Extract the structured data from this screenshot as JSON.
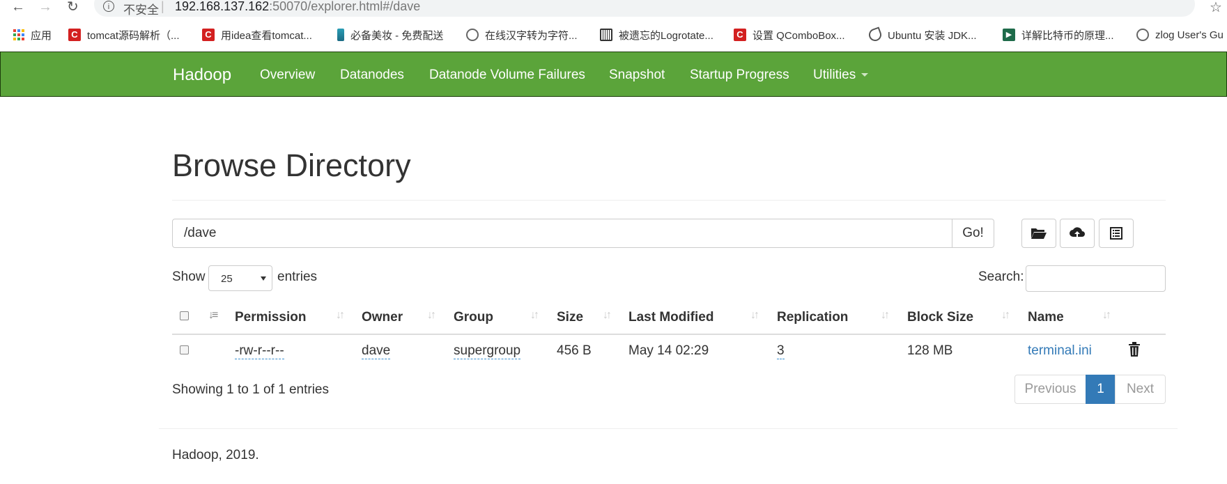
{
  "browser": {
    "insecure_label": "不安全",
    "url_host": "192.168.137.162",
    "url_rest": ":50070/explorer.html#/dave"
  },
  "bookmarks": [
    {
      "label": "应用",
      "icon": "apps-grid-icon"
    },
    {
      "label": "tomcat源码解析（...",
      "icon": "csdn-icon"
    },
    {
      "label": "用idea查看tomcat...",
      "icon": "csdn-icon"
    },
    {
      "label": "必备美妆 - 免费配送",
      "icon": "cup-icon"
    },
    {
      "label": "在线汉字转为字符...",
      "icon": "globe-icon"
    },
    {
      "label": "被遗忘的Logrotate...",
      "icon": "frame-icon"
    },
    {
      "label": "设置 QComboBox...",
      "icon": "csdn-icon"
    },
    {
      "label": "Ubuntu 安装 JDK...",
      "icon": "ubuntu-icon"
    },
    {
      "label": "详解比特币的原理...",
      "icon": "play-icon"
    },
    {
      "label": "zlog User's Gu",
      "icon": "globe-icon"
    }
  ],
  "navbar": {
    "brand": "Hadoop",
    "items": [
      "Overview",
      "Datanodes",
      "Datanode Volume Failures",
      "Snapshot",
      "Startup Progress",
      "Utilities"
    ]
  },
  "page": {
    "title": "Browse Directory",
    "path_value": "/dave",
    "go_label": "Go!"
  },
  "controls": {
    "show_label": "Show",
    "page_size": "25",
    "entries_label": "entries",
    "search_label": "Search:"
  },
  "table": {
    "columns": [
      "Permission",
      "Owner",
      "Group",
      "Size",
      "Last Modified",
      "Replication",
      "Block Size",
      "Name"
    ],
    "rows": [
      {
        "permission": "-rw-r--r--",
        "owner": "dave",
        "group": "supergroup",
        "size": "456 B",
        "modified": "May 14 02:29",
        "replication": "3",
        "block_size": "128 MB",
        "name": "terminal.ini"
      }
    ]
  },
  "pagination": {
    "info": "Showing 1 to 1 of 1 entries",
    "previous": "Previous",
    "current": "1",
    "next": "Next"
  },
  "footer": {
    "text": "Hadoop, 2019."
  },
  "colors": {
    "navbar": "#5ba43a",
    "link": "#337ab7",
    "active_page": "#337ab7"
  }
}
